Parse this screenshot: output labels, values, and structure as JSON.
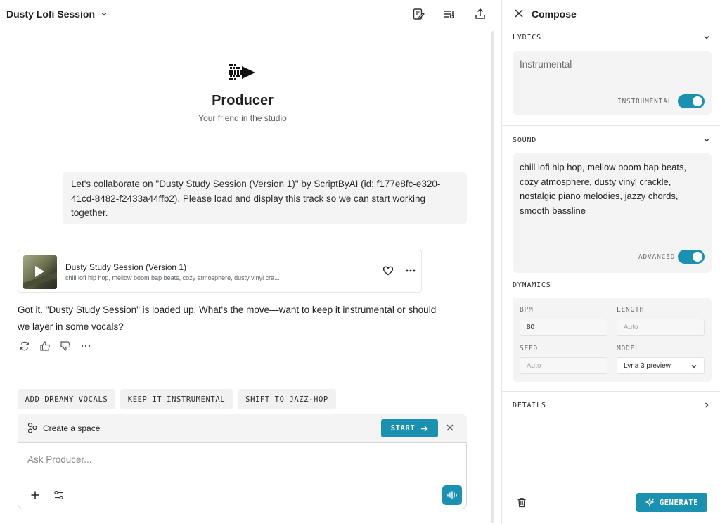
{
  "header": {
    "title": "Dusty Lofi Session",
    "icons": [
      "notebook-edit-icon",
      "playlist-icon",
      "share-icon"
    ]
  },
  "agent": {
    "name": "Producer",
    "tagline": "Your friend in the studio"
  },
  "chat": {
    "user_message": "Let's collaborate on \"Dusty Study Session (Version 1)\" by ScriptByAI (id: f177e8fc-e320-41cd-8482-f2433a44ffb2). Please load and display this track so we can start working together.",
    "track": {
      "title": "Dusty Study Session (Version 1)",
      "description": "chill lofi hip hop, mellow boom bap beats, cozy atmosphere, dusty vinyl cra..."
    },
    "reply": "Got it. \"Dusty Study Session\" is loaded up. What's the move—want to keep it instrumental or should we layer in some vocals?",
    "suggestions": [
      "ADD DREAMY VOCALS",
      "KEEP IT INSTRUMENTAL",
      "SHIFT TO JAZZ-HOP"
    ]
  },
  "space": {
    "label": "Create a space",
    "start_label": "START"
  },
  "composer": {
    "placeholder": "Ask Producer..."
  },
  "compose_panel": {
    "title": "Compose",
    "lyrics": {
      "label": "LYRICS",
      "text": "Instrumental",
      "toggle_label": "INSTRUMENTAL",
      "toggle_on": true
    },
    "sound": {
      "label": "SOUND",
      "text": "chill lofi hip hop, mellow boom bap beats, cozy atmosphere, dusty vinyl crackle, nostalgic piano melodies, jazzy chords, smooth bassline",
      "toggle_label": "ADVANCED",
      "toggle_on": true
    },
    "dynamics": {
      "label": "DYNAMICS",
      "bpm_label": "BPM",
      "bpm_value": "80",
      "length_label": "LENGTH",
      "length_placeholder": "Auto",
      "seed_label": "SEED",
      "seed_placeholder": "Auto",
      "model_label": "MODEL",
      "model_value": "Lyria 3 preview"
    },
    "details_label": "DETAILS",
    "generate_label": "GENERATE"
  },
  "colors": {
    "accent": "#1a91b0",
    "panel_bg": "#f4f4f4"
  }
}
